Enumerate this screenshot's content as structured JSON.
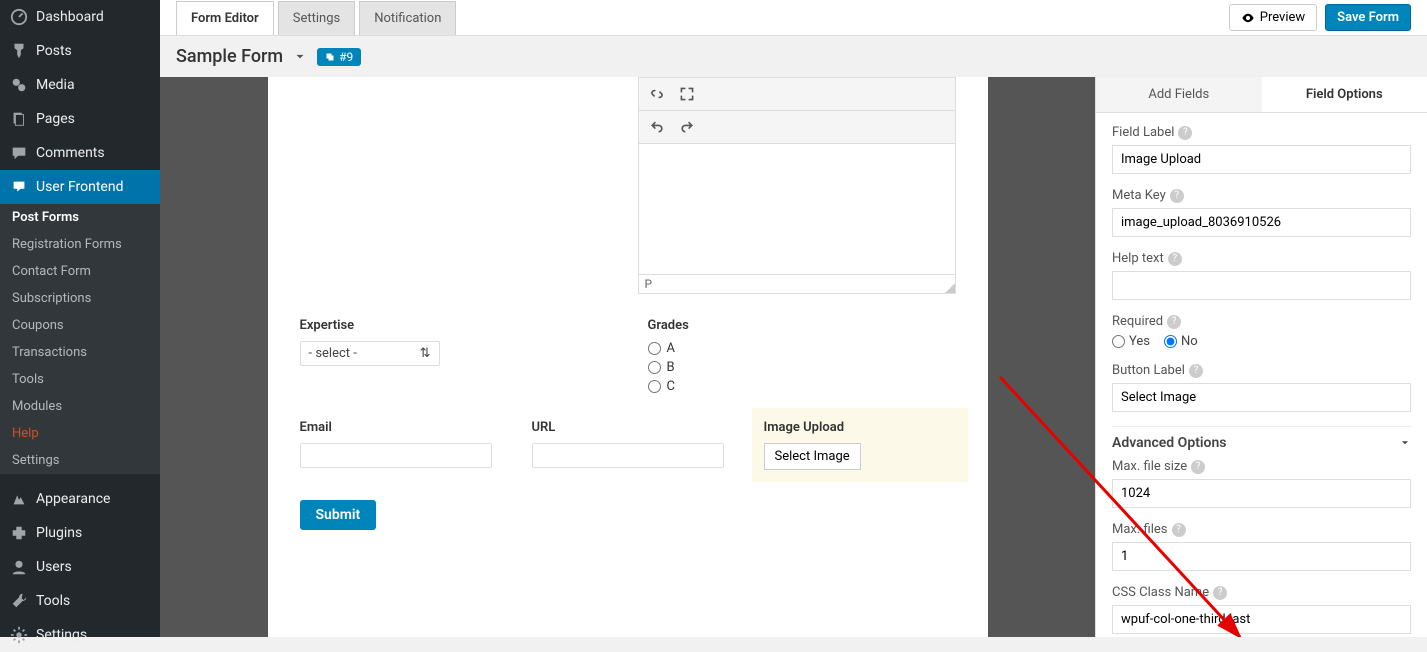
{
  "sidebar": {
    "items": [
      {
        "icon": "dashboard",
        "label": "Dashboard"
      },
      {
        "icon": "pin",
        "label": "Posts"
      },
      {
        "icon": "media",
        "label": "Media"
      },
      {
        "icon": "page",
        "label": "Pages"
      },
      {
        "icon": "comment",
        "label": "Comments"
      },
      {
        "icon": "wpuf",
        "label": "User Frontend",
        "active": true
      }
    ],
    "subs": [
      {
        "label": "Post Forms",
        "first": true
      },
      {
        "label": "Registration Forms"
      },
      {
        "label": "Contact Form"
      },
      {
        "label": "Subscriptions"
      },
      {
        "label": "Coupons"
      },
      {
        "label": "Transactions"
      },
      {
        "label": "Tools"
      },
      {
        "label": "Modules"
      },
      {
        "label": "Help",
        "help": true
      },
      {
        "label": "Settings"
      }
    ],
    "bottom": [
      {
        "icon": "appearance",
        "label": "Appearance"
      },
      {
        "icon": "plugins",
        "label": "Plugins"
      },
      {
        "icon": "users",
        "label": "Users"
      },
      {
        "icon": "tools",
        "label": "Tools"
      },
      {
        "icon": "settings",
        "label": "Settings"
      }
    ]
  },
  "top": {
    "tabs": [
      {
        "label": "Form Editor",
        "active": true
      },
      {
        "label": "Settings"
      },
      {
        "label": "Notification"
      }
    ],
    "preview": "Preview",
    "save": "Save Form"
  },
  "title": {
    "name": "Sample Form",
    "badge": "#9"
  },
  "canvas": {
    "editor_status": "P",
    "expertise": {
      "label": "Expertise",
      "select": "- select -"
    },
    "grades": {
      "label": "Grades",
      "options": [
        "A",
        "B",
        "C"
      ]
    },
    "email": {
      "label": "Email"
    },
    "url": {
      "label": "URL"
    },
    "image": {
      "label": "Image Upload",
      "button": "Select Image"
    },
    "submit": "Submit"
  },
  "options": {
    "tabs": [
      "Add Fields",
      "Field Options"
    ],
    "activeTab": 1,
    "field_label": {
      "label": "Field Label",
      "value": "Image Upload"
    },
    "meta_key": {
      "label": "Meta Key",
      "value": "image_upload_8036910526"
    },
    "help_text": {
      "label": "Help text",
      "value": ""
    },
    "required": {
      "label": "Required",
      "options": [
        "Yes",
        "No"
      ],
      "selected": "No"
    },
    "button_label": {
      "label": "Button Label",
      "value": "Select Image"
    },
    "advanced": "Advanced Options",
    "max_size": {
      "label": "Max. file size",
      "value": "1024"
    },
    "max_files": {
      "label": "Max. files",
      "value": "1"
    },
    "css_class": {
      "label": "CSS Class Name",
      "value": "wpuf-col-one-third-last"
    }
  }
}
